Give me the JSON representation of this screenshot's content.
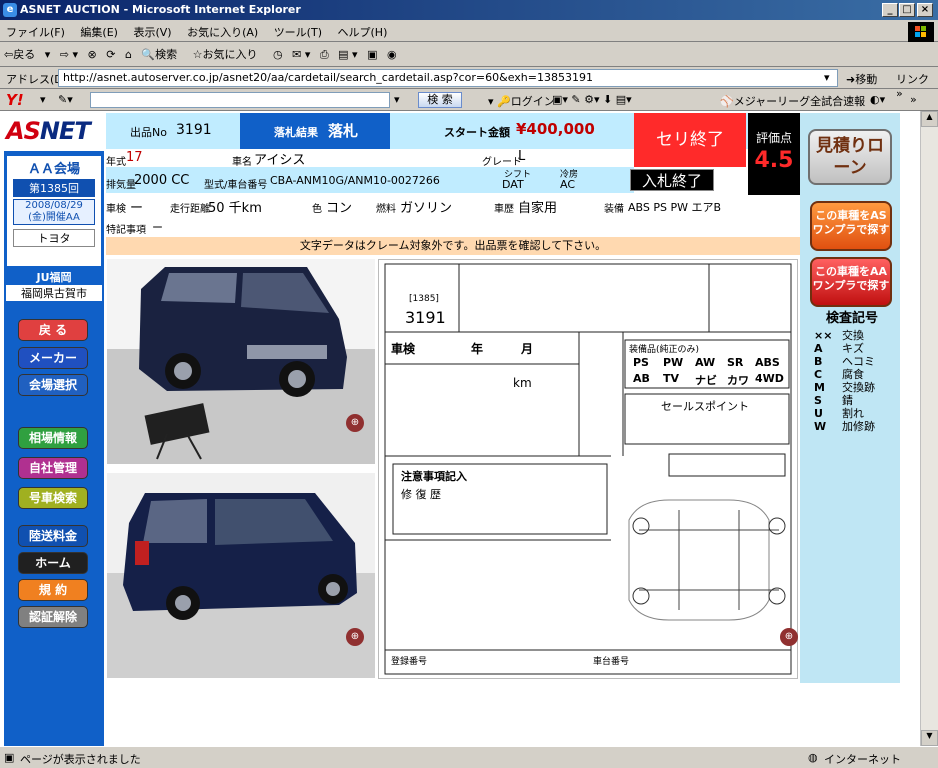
{
  "window": {
    "title": "ASNET AUCTION - Microsoft Internet Explorer"
  },
  "menu": [
    "ファイル(F)",
    "編集(E)",
    "表示(V)",
    "お気に入り(A)",
    "ツール(T)",
    "ヘルプ(H)"
  ],
  "toolbar": {
    "back": "戻る",
    "search": "検索",
    "favorites": "お気に入り"
  },
  "address": {
    "label": "アドレス(D)",
    "url": "http://asnet.autoserver.co.jp/asnet20/aa/cardetail/search_cardetail.asp?cor=60&exh=13853191",
    "go": "移動",
    "links": "リンク"
  },
  "yahoo_toolbar": {
    "search_btn": "検 索",
    "login": "ログイン",
    "news": "メジャーリーグ全試合速報"
  },
  "status": {
    "text": "ページが表示されました",
    "zone": "インターネット"
  },
  "left": {
    "venue_title": "ＡＡ会場",
    "round": "第1385回",
    "date": "2008/08/29",
    "date2": "(金)開催AA",
    "maker": "トヨタ",
    "venue_name": "JU福岡",
    "venue_location": "福岡県古賀市",
    "buttons": {
      "back": "戻 る",
      "maker": "メーカー",
      "venue": "会場選択",
      "market": "相場情報",
      "own": "自社管理",
      "number": "号車検索",
      "land": "陸送料金",
      "home": "ホーム",
      "terms": "規 約",
      "logout": "認証解除"
    }
  },
  "header": {
    "lot_label": "出品No",
    "lot_number": "3191",
    "result_label": "落札結果",
    "result_value": "落札",
    "start_label": "スタート金額",
    "start_value": "¥400,000",
    "status": "セリ終了",
    "score_label": "評価点",
    "score_value": "4.5",
    "estimate_button": "見積りローン"
  },
  "details": {
    "year_label": "年式",
    "year": "17",
    "name_label": "車名",
    "name": "アイシス",
    "grade_label": "グレード",
    "grade": "L",
    "cc_label": "排気量",
    "cc": "2000 CC",
    "model_label": "型式/車台番号",
    "model": "CBA-ANM10G/ANM10-0027266",
    "shift_label": "シフト",
    "shift": "DAT",
    "ac_label": "冷房",
    "ac": "AC",
    "bid_end": "入札終了",
    "inspection_label": "車検",
    "inspection": "ー",
    "mileage_label": "走行距離",
    "mileage": "50 千km",
    "color_label": "色",
    "color": "コン",
    "fuel_label": "燃料",
    "fuel": "ガソリン",
    "usage_label": "車歴",
    "usage": "自家用",
    "equip_label": "装備",
    "equip": "ABS PS PW エアB",
    "notes_label": "特記事項",
    "notes": "ー"
  },
  "warning": "文字データはクレーム対象外です。出品票を確認して下さい。",
  "right": {
    "btn1": "この車種をASワンプラで探す",
    "btn2": "この車種をAAワンプラで探す",
    "legend_title": "検査記号",
    "legend": [
      {
        "code": "××",
        "meaning": "交換"
      },
      {
        "code": "A",
        "meaning": "キズ"
      },
      {
        "code": "B",
        "meaning": "ヘコミ"
      },
      {
        "code": "C",
        "meaning": "腐食"
      },
      {
        "code": "M",
        "meaning": "交換跡"
      },
      {
        "code": "S",
        "meaning": "錆"
      },
      {
        "code": "U",
        "meaning": "割れ"
      },
      {
        "code": "W",
        "meaning": "加修跡"
      }
    ]
  },
  "sheet": {
    "lot_small": "[1385]",
    "lot": "3191",
    "row_inspection": "車検",
    "row_year": "年",
    "row_month": "月",
    "km": "km",
    "caution": "注意事項記入",
    "repair": "修 復 歴",
    "equip_header": "装備品(純正のみ)",
    "eq1": "PS",
    "eq2": "PW",
    "eq3": "AW",
    "eq4": "SR",
    "eq5": "ABS",
    "eq6": "AB",
    "eq7": "TV",
    "eq8": "ナビ",
    "eq9": "カワ",
    "eq10": "4WD",
    "sales_point": "セールスポイント",
    "register": "登録番号",
    "chassis": "車台番号"
  },
  "colors": {
    "accent_blue": "#1060c8",
    "status_red": "#ff2a2a",
    "cyan": "#c0ecff"
  }
}
